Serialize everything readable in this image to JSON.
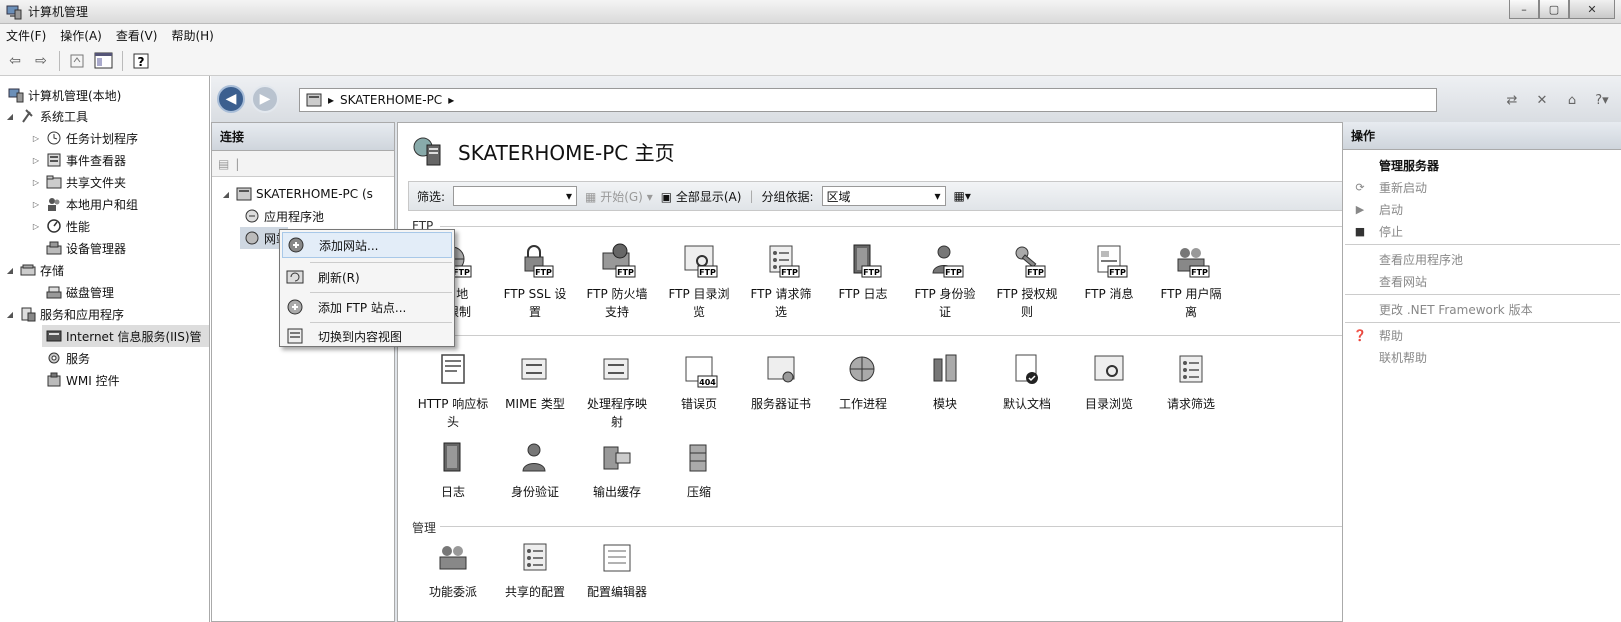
{
  "window": {
    "title": "计算机管理",
    "controls": [
      "–",
      "▢",
      "✕"
    ]
  },
  "menubar": [
    "文件(F)",
    "操作(A)",
    "查看(V)",
    "帮助(H)"
  ],
  "tree": {
    "root": "计算机管理(本地)",
    "items": [
      {
        "label": "系统工具"
      },
      {
        "label": "任务计划程序"
      },
      {
        "label": "事件查看器"
      },
      {
        "label": "共享文件夹"
      },
      {
        "label": "本地用户和组"
      },
      {
        "label": "性能"
      },
      {
        "label": "设备管理器"
      },
      {
        "label": "存储"
      },
      {
        "label": "磁盘管理"
      },
      {
        "label": "服务和应用程序"
      },
      {
        "label": "Internet 信息服务(IIS)管"
      },
      {
        "label": "服务"
      },
      {
        "label": "WMI 控件"
      }
    ]
  },
  "address": {
    "path": "SKATERHOME-PC"
  },
  "connections": {
    "title": "连接",
    "server": "SKATERHOME-PC (s",
    "app_pools": "应用程序池",
    "sites": "网站"
  },
  "context_menu": {
    "items": [
      "添加网站...",
      "刷新(R)",
      "添加 FTP 站点...",
      "切换到内容视图"
    ]
  },
  "center": {
    "title": "SKATERHOME-PC 主页",
    "filter_label": "筛选:",
    "start_label": "开始(G)",
    "show_all_label": "全部显示(A)",
    "group_by_label": "分组依据:",
    "group_by_value": "区域",
    "sections": {
      "ftp": "FTP",
      "manage": "管理"
    },
    "ftp_features": [
      {
        "line1": "v4 地",
        "line2": "或限制"
      },
      {
        "line1": "FTP SSL 设",
        "line2": "置"
      },
      {
        "line1": "FTP 防火墙",
        "line2": "支持"
      },
      {
        "line1": "FTP 目录浏",
        "line2": "览"
      },
      {
        "line1": "FTP 请求筛",
        "line2": "选"
      },
      {
        "line1": "FTP 日志",
        "line2": ""
      },
      {
        "line1": "FTP 身份验",
        "line2": "证"
      },
      {
        "line1": "FTP 授权规",
        "line2": "则"
      },
      {
        "line1": "FTP 消息",
        "line2": ""
      },
      {
        "line1": "FTP 用户隔",
        "line2": "离"
      }
    ],
    "iis_features": [
      {
        "line1": "HTTP 响应标",
        "line2": "头"
      },
      {
        "line1": "MIME 类型",
        "line2": ""
      },
      {
        "line1": "处理程序映",
        "line2": "射"
      },
      {
        "line1": "错误页",
        "line2": ""
      },
      {
        "line1": "服务器证书",
        "line2": ""
      },
      {
        "line1": "工作进程",
        "line2": ""
      },
      {
        "line1": "模块",
        "line2": ""
      },
      {
        "line1": "默认文档",
        "line2": ""
      },
      {
        "line1": "目录浏览",
        "line2": ""
      },
      {
        "line1": "请求筛选",
        "line2": ""
      }
    ],
    "iis_features_row2": [
      {
        "line1": "日志",
        "line2": ""
      },
      {
        "line1": "身份验证",
        "line2": ""
      },
      {
        "line1": "输出缓存",
        "line2": ""
      },
      {
        "line1": "压缩",
        "line2": ""
      }
    ],
    "manage_features": [
      {
        "line1": "功能委派",
        "line2": ""
      },
      {
        "line1": "共享的配置",
        "line2": ""
      },
      {
        "line1": "配置编辑器",
        "line2": ""
      }
    ],
    "ftp_badge": "FTP",
    "error_badge": "404"
  },
  "actions": {
    "title": "操作",
    "manage_server": "管理服务器",
    "restart": "重新启动",
    "start": "启动",
    "stop": "停止",
    "view_app_pools": "查看应用程序池",
    "view_sites": "查看网站",
    "change_net": "更改 .NET Framework 版本",
    "help": "帮助",
    "online_help": "联机帮助"
  }
}
